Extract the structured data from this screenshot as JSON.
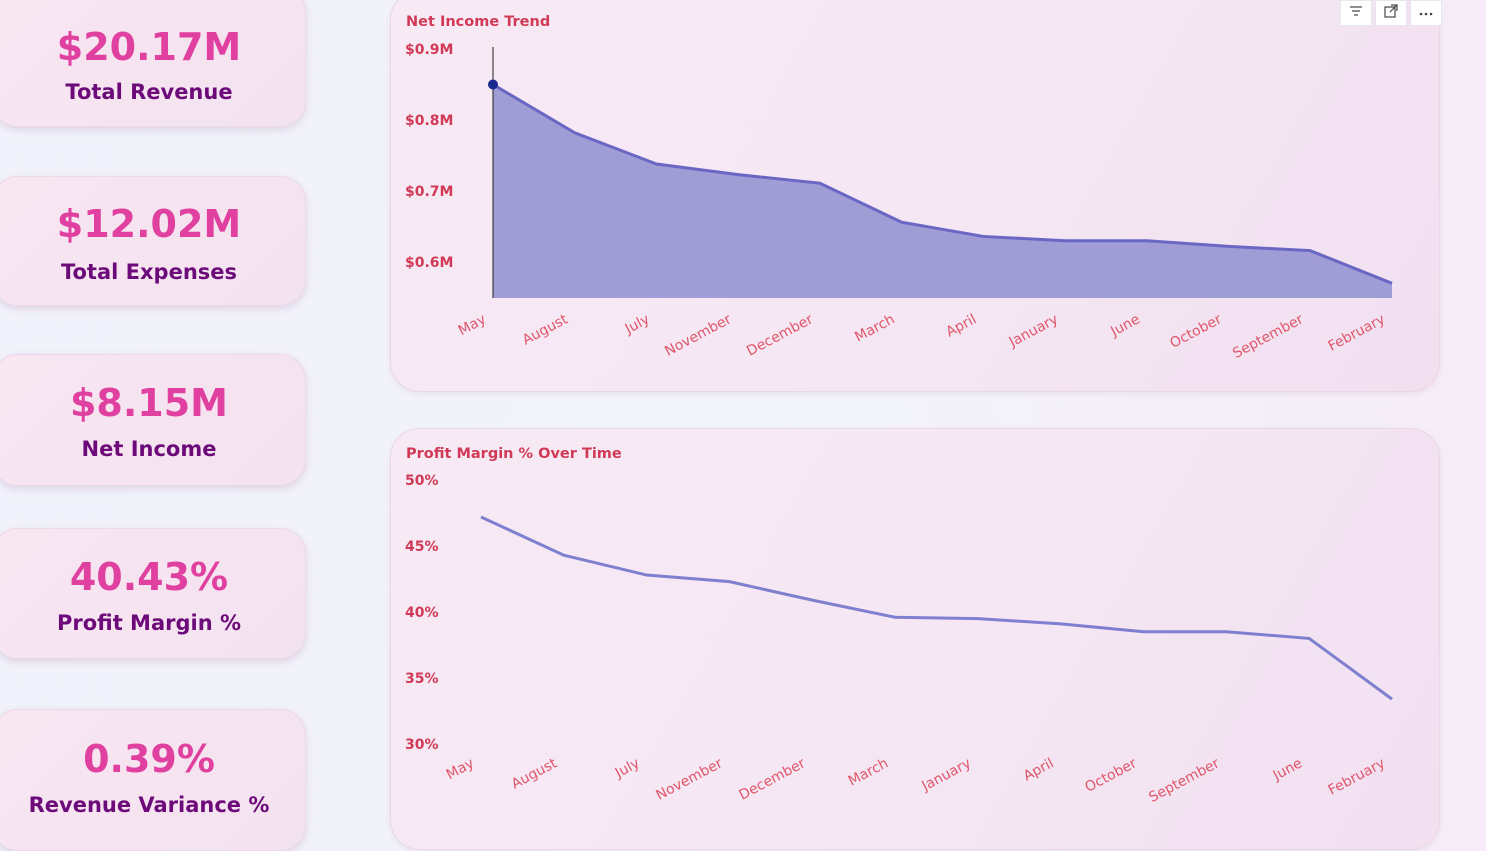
{
  "kpis": [
    {
      "value": "$20.17M",
      "label": "Total Revenue"
    },
    {
      "value": "$12.02M",
      "label": "Total Expenses"
    },
    {
      "value": "$8.15M",
      "label": "Net Income"
    },
    {
      "value": "40.43%",
      "label": "Profit Margin %"
    },
    {
      "value": "0.39%",
      "label": "Revenue Variance %"
    }
  ],
  "toolbar": {
    "icons": [
      "filter-icon",
      "focus-mode-icon",
      "more-options-icon"
    ]
  },
  "colors": {
    "accent_value": "#e0409f",
    "accent_label": "#6d0a7a",
    "title": "#d13a56",
    "area_fill": "#9b98d4",
    "line": "#6a66c4",
    "line2": "#7f7fd0"
  },
  "chart_data": [
    {
      "type": "area",
      "title": "Net Income Trend",
      "categories": [
        "May",
        "August",
        "July",
        "November",
        "December",
        "March",
        "April",
        "January",
        "June",
        "October",
        "September",
        "February"
      ],
      "values": [
        0.85,
        0.782,
        0.738,
        0.723,
        0.711,
        0.656,
        0.636,
        0.63,
        0.63,
        0.622,
        0.616,
        0.57
      ],
      "ylim": [
        0.55,
        0.9
      ],
      "yticks": [
        "$0.6M",
        "$0.7M",
        "$0.8M",
        "$0.9M"
      ],
      "ytick_values": [
        0.6,
        0.7,
        0.8,
        0.9
      ]
    },
    {
      "type": "line",
      "title": "Profit Margin % Over Time",
      "categories": [
        "May",
        "August",
        "July",
        "November",
        "December",
        "March",
        "January",
        "April",
        "October",
        "September",
        "June",
        "February"
      ],
      "values": [
        47.2,
        44.3,
        42.8,
        42.3,
        40.9,
        39.6,
        39.5,
        39.1,
        38.5,
        38.5,
        38.0,
        33.4
      ],
      "ylim": [
        30,
        50
      ],
      "yticks": [
        "30%",
        "35%",
        "40%",
        "45%",
        "50%"
      ],
      "ytick_values": [
        30,
        35,
        40,
        45,
        50
      ]
    }
  ]
}
